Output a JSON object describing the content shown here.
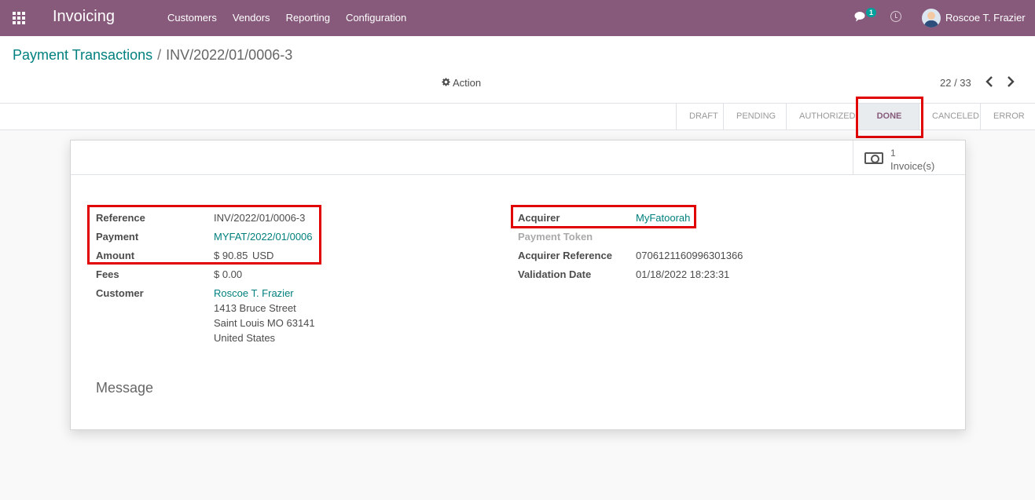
{
  "app": {
    "title": "Invoicing"
  },
  "menu": {
    "items": [
      "Customers",
      "Vendors",
      "Reporting",
      "Configuration"
    ]
  },
  "systray": {
    "chat_count": "1",
    "user_name": "Roscoe T. Frazier"
  },
  "breadcrumb": {
    "parent": "Payment Transactions",
    "separator": "/",
    "current": "INV/2022/01/0006-3"
  },
  "control": {
    "action_label": "Action",
    "pager": "22 / 33"
  },
  "statusbar": {
    "stages": [
      "DRAFT",
      "PENDING",
      "AUTHORIZED",
      "DONE",
      "CANCELED",
      "ERROR"
    ],
    "active_stage": "DONE"
  },
  "smart_button": {
    "count": "1",
    "label": "Invoice(s)"
  },
  "left_fields": {
    "reference": {
      "label": "Reference",
      "value": "INV/2022/01/0006-3"
    },
    "payment": {
      "label": "Payment",
      "value": "MYFAT/2022/01/0006"
    },
    "amount": {
      "label": "Amount",
      "value": "$ 90.85",
      "currency": "USD"
    },
    "fees": {
      "label": "Fees",
      "value": "$ 0.00"
    },
    "customer": {
      "label": "Customer",
      "name": "Roscoe T. Frazier",
      "street": "1413 Bruce Street",
      "city": "Saint Louis MO 63141",
      "country": "United States"
    }
  },
  "right_fields": {
    "acquirer": {
      "label": "Acquirer",
      "value": "MyFatoorah"
    },
    "payment_token": {
      "label": "Payment Token",
      "value": ""
    },
    "acquirer_reference": {
      "label": "Acquirer Reference",
      "value": "0706121160996301366"
    },
    "validation_date": {
      "label": "Validation Date",
      "value": "01/18/2022 18:23:31"
    }
  },
  "message": {
    "title": "Message"
  },
  "colors": {
    "navbar": "#875a7b",
    "link": "#00807e",
    "highlight": "#e00000"
  }
}
